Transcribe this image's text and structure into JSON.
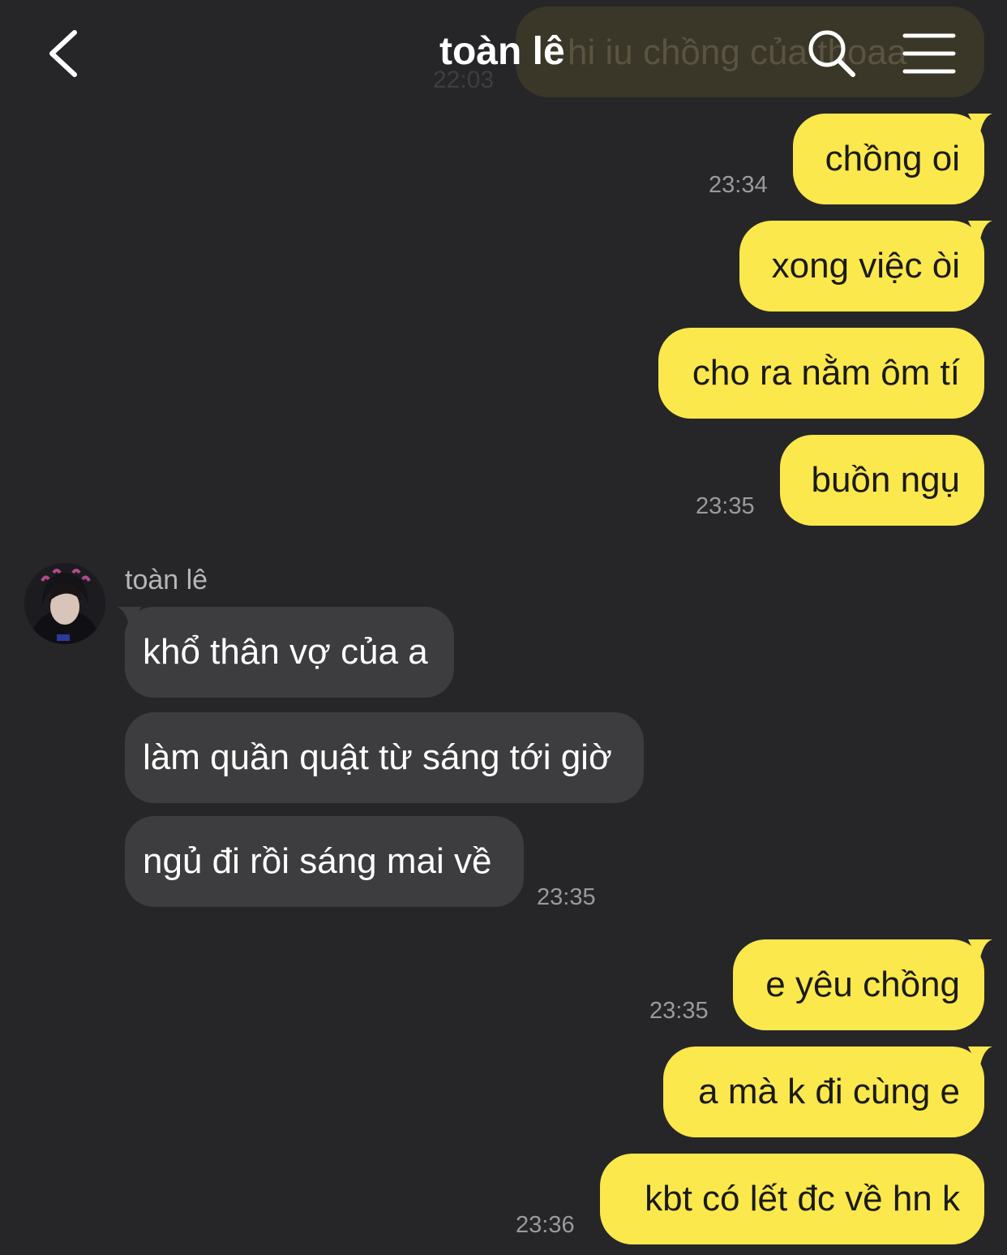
{
  "header": {
    "title": "toàn lê",
    "back_icon": "chevron-left-icon",
    "search_icon": "search-icon",
    "menu_icon": "hamburger-menu-icon"
  },
  "colors": {
    "background": "#262628",
    "outgoing_bubble": "#fbe84c",
    "incoming_bubble": "#3d3d3f"
  },
  "previous": {
    "text": "hi iu chồng của thoaa",
    "time": "22:03"
  },
  "outgoing_1": [
    {
      "text": "chồng oi"
    },
    {
      "text": "xong việc òi"
    },
    {
      "text": "cho ra nằm ôm tí"
    },
    {
      "text": "buồn ngụ"
    }
  ],
  "outgoing_1_times": [
    "23:34",
    "23:35"
  ],
  "incoming": {
    "sender": "toàn lê",
    "messages": [
      {
        "text": "khổ thân vợ của a"
      },
      {
        "text": "làm quần quật từ sáng tới giờ"
      },
      {
        "text": "ngủ đi rồi sáng mai về"
      }
    ],
    "time": "23:35"
  },
  "outgoing_2": [
    {
      "text": "e yêu chồng"
    },
    {
      "text": "a mà k đi cùng e"
    },
    {
      "text": "kbt có lết đc về hn k"
    }
  ],
  "outgoing_2_times": [
    "23:35",
    "23:36"
  ]
}
